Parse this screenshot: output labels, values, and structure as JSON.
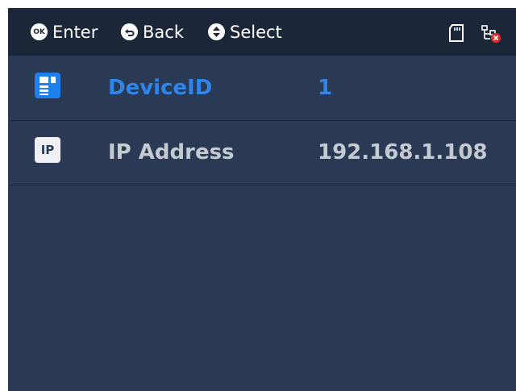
{
  "header": {
    "enter_label": "Enter",
    "enter_glyph": "OK",
    "back_label": "Back",
    "select_label": "Select",
    "status_icons": [
      "sd-card-icon",
      "network-disconnected-icon"
    ]
  },
  "menu": {
    "items": [
      {
        "label": "DeviceID",
        "value": "1",
        "icon": "device-id-icon",
        "selected": true
      },
      {
        "label": "IP Address",
        "value": "192.168.1.108",
        "icon": "ip-icon",
        "icon_text": "IP",
        "selected": false
      }
    ]
  },
  "colors": {
    "background": "#2a3a54",
    "header": "#1b2739",
    "selected_text": "#2e86e8",
    "normal_text": "#c4c9d2"
  }
}
